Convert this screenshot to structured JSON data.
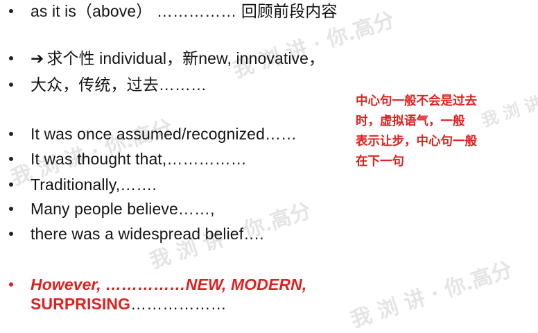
{
  "bullets": [
    {
      "text": "as it is（above） …………… 回顾前段内容"
    },
    {
      "arrow": "➔",
      "text": "求个性 individual，新new, innovative，"
    },
    {
      "text": "大众，传统，过去………"
    },
    {
      "text": "It was once assumed/recognized……"
    },
    {
      "text": "It was thought that,……………"
    },
    {
      "text": "Traditionally,……."
    },
    {
      "text": "Many people believe……,"
    },
    {
      "text": "there was a widespread belief…."
    }
  ],
  "highlight": {
    "line1": "However, ……………NEW, MODERN,",
    "line2_bold": "SURPRISING",
    "line2_plain": "………………"
  },
  "note": [
    "中心句一般不会是过去",
    "时，虚拟语气，一般",
    "表示让步，中心句一般",
    "在下一句"
  ],
  "watermark": {
    "text": "我 浏 讲 · 你.高分"
  },
  "colors": {
    "accent_red": "#e02020",
    "text": "#141414",
    "watermark": "#d9d9d9"
  }
}
